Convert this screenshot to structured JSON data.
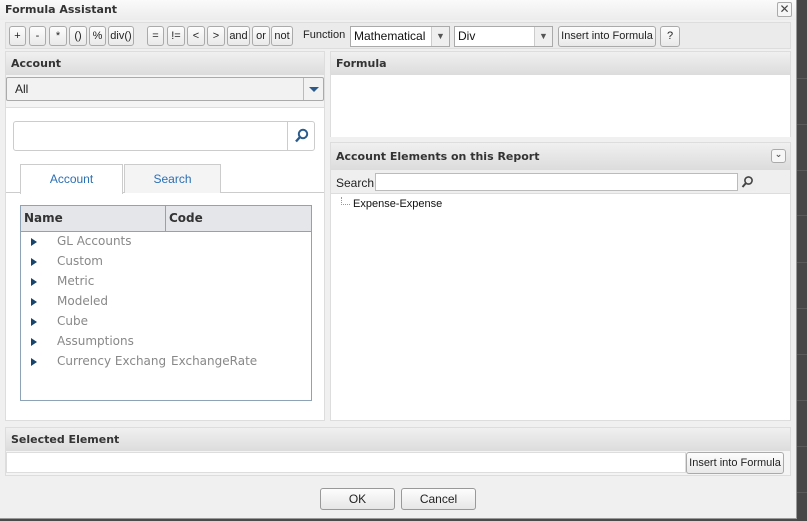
{
  "window": {
    "title": "Formula Assistant",
    "close_icon": "close-icon"
  },
  "toolbar": {
    "operators": [
      "+",
      "-",
      "*",
      "()",
      "%",
      "div()"
    ],
    "comparators": [
      "=",
      "!=",
      "<",
      ">",
      "and",
      "or",
      "not"
    ],
    "function_label": "Function",
    "function_category": "Mathematical",
    "function_name": "Div",
    "insert_label": "Insert into Formula",
    "help_label": "?"
  },
  "account_panel": {
    "title": "Account",
    "dimension_select": "All",
    "search_placeholder": "",
    "search_icon": "search-icon",
    "tabs": [
      {
        "label": "Account",
        "active": true
      },
      {
        "label": "Search",
        "active": false
      }
    ],
    "tree": {
      "columns": [
        "Name",
        "Code"
      ],
      "rows": [
        {
          "name": "GL Accounts",
          "code": ""
        },
        {
          "name": "Custom",
          "code": ""
        },
        {
          "name": "Metric",
          "code": ""
        },
        {
          "name": "Modeled",
          "code": ""
        },
        {
          "name": "Cube",
          "code": ""
        },
        {
          "name": "Assumptions",
          "code": ""
        },
        {
          "name": "Currency Exchange",
          "code": "ExchangeRate"
        }
      ]
    }
  },
  "formula_panel": {
    "title": "Formula",
    "value": ""
  },
  "elements_panel": {
    "title": "Account Elements on this Report",
    "search_label": "Search",
    "search_value": "",
    "items": [
      "Expense-Expense"
    ]
  },
  "selected_panel": {
    "title": "Selected Element",
    "value": "",
    "insert_label": "Insert into Formula"
  },
  "footer": {
    "ok_label": "OK",
    "cancel_label": "Cancel"
  },
  "colors": {
    "tab_text": "#2a6fb5",
    "tree_arrow": "#17456b",
    "background": "#4a4a4a"
  }
}
